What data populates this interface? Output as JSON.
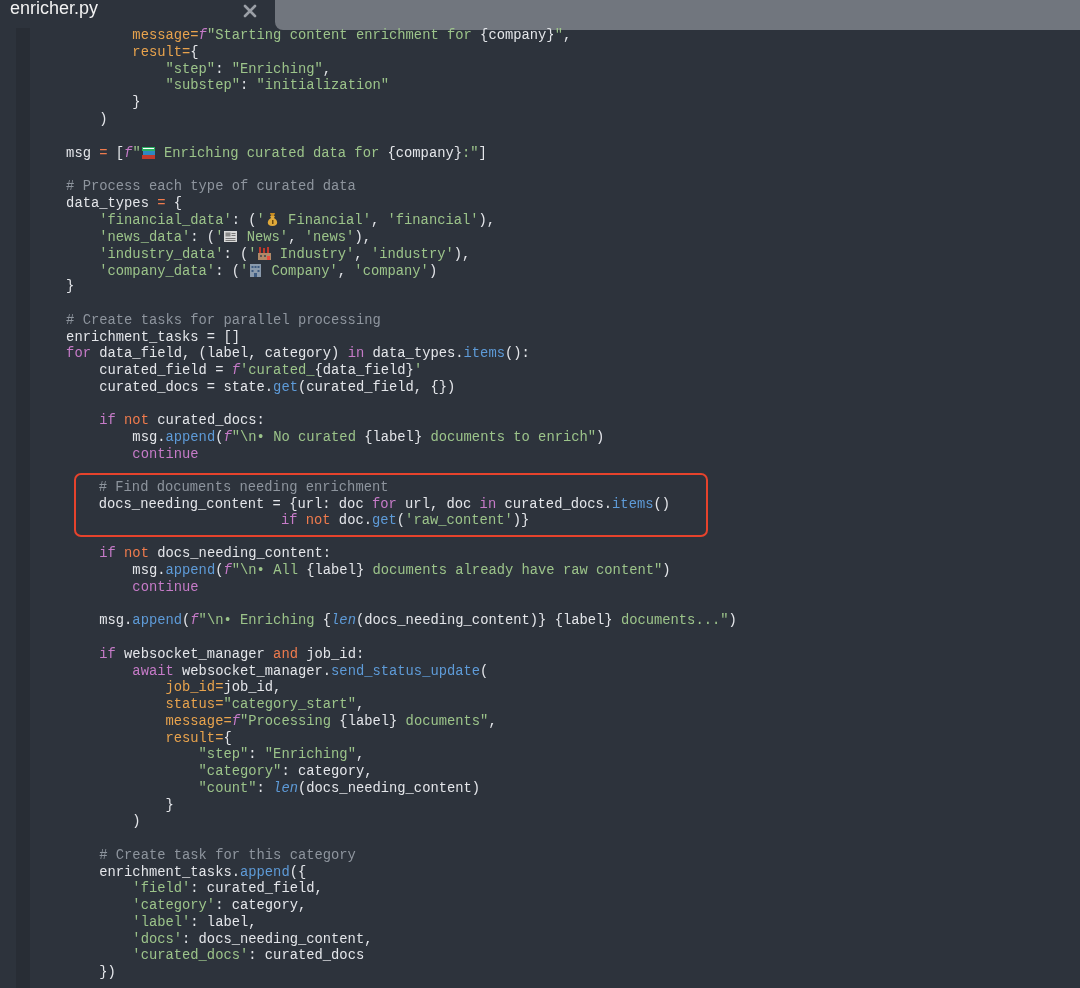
{
  "tab": {
    "title": "enricher.py"
  },
  "blocks": [
    {
      "highlighted": false,
      "lines": [
        {
          "kind": "code",
          "tokens": [
            {
              "kind": "param",
              "text": "            message="
            },
            {
              "kind": "fpre",
              "text": "f"
            },
            {
              "kind": "str",
              "text": "\"Starting content enrichment for "
            },
            {
              "kind": "plain",
              "text": "{company}"
            },
            {
              "kind": "str",
              "text": "\""
            },
            {
              "kind": "plain",
              "text": ","
            }
          ]
        },
        {
          "kind": "code",
          "tokens": [
            {
              "kind": "param",
              "text": "            result="
            },
            {
              "kind": "plain",
              "text": "{"
            }
          ]
        },
        {
          "kind": "code",
          "tokens": [
            {
              "kind": "str",
              "text": "                \"step\""
            },
            {
              "kind": "plain",
              "text": ": "
            },
            {
              "kind": "str",
              "text": "\"Enriching\""
            },
            {
              "kind": "plain",
              "text": ","
            }
          ]
        },
        {
          "kind": "code",
          "tokens": [
            {
              "kind": "str",
              "text": "                \"substep\""
            },
            {
              "kind": "plain",
              "text": ": "
            },
            {
              "kind": "str",
              "text": "\"initialization\""
            }
          ]
        },
        {
          "kind": "code",
          "tokens": [
            {
              "kind": "plain",
              "text": "            }"
            }
          ]
        },
        {
          "kind": "code",
          "tokens": [
            {
              "kind": "plain",
              "text": "        )"
            }
          ]
        },
        {
          "kind": "blank"
        },
        {
          "kind": "code",
          "tokens": [
            {
              "kind": "plain",
              "text": "    msg "
            },
            {
              "kind": "op",
              "text": "="
            },
            {
              "kind": "plain",
              "text": " ["
            },
            {
              "kind": "fpre",
              "text": "f"
            },
            {
              "kind": "str",
              "text": "\""
            },
            {
              "kind": "icon"
            },
            {
              "kind": "str",
              "text": " Enriching curated data for "
            },
            {
              "kind": "plain",
              "text": "{company}"
            },
            {
              "kind": "str",
              "text": ":\""
            },
            {
              "kind": "plain",
              "text": "]"
            }
          ]
        },
        {
          "kind": "blank"
        },
        {
          "kind": "code",
          "tokens": [
            {
              "kind": "cmt",
              "text": "    # Process each type of curated data"
            }
          ]
        },
        {
          "kind": "code",
          "tokens": [
            {
              "kind": "plain",
              "text": "    data_types "
            },
            {
              "kind": "op",
              "text": "="
            },
            {
              "kind": "plain",
              "text": " {"
            }
          ]
        },
        {
          "kind": "code",
          "tokens": [
            {
              "kind": "str",
              "text": "        'financial_data'"
            },
            {
              "kind": "plain",
              "text": ": ("
            },
            {
              "kind": "str",
              "text": "'"
            },
            {
              "kind": "icon"
            },
            {
              "kind": "str",
              "text": " Financial'"
            },
            {
              "kind": "plain",
              "text": ", "
            },
            {
              "kind": "str",
              "text": "'financial'"
            },
            {
              "kind": "plain",
              "text": "),"
            }
          ]
        },
        {
          "kind": "code",
          "tokens": [
            {
              "kind": "str",
              "text": "        'news_data'"
            },
            {
              "kind": "plain",
              "text": ": ("
            },
            {
              "kind": "str",
              "text": "'"
            },
            {
              "kind": "icon"
            },
            {
              "kind": "str",
              "text": " News'"
            },
            {
              "kind": "plain",
              "text": ", "
            },
            {
              "kind": "str",
              "text": "'news'"
            },
            {
              "kind": "plain",
              "text": "),"
            }
          ]
        },
        {
          "kind": "code",
          "tokens": [
            {
              "kind": "str",
              "text": "        'industry_data'"
            },
            {
              "kind": "plain",
              "text": ": ("
            },
            {
              "kind": "str",
              "text": "'"
            },
            {
              "kind": "icon"
            },
            {
              "kind": "str",
              "text": " Industry'"
            },
            {
              "kind": "plain",
              "text": ", "
            },
            {
              "kind": "str",
              "text": "'industry'"
            },
            {
              "kind": "plain",
              "text": "),"
            }
          ]
        },
        {
          "kind": "code",
          "tokens": [
            {
              "kind": "str",
              "text": "        'company_data'"
            },
            {
              "kind": "plain",
              "text": ": ("
            },
            {
              "kind": "str",
              "text": "'"
            },
            {
              "kind": "icon"
            },
            {
              "kind": "str",
              "text": " Company'"
            },
            {
              "kind": "plain",
              "text": ", "
            },
            {
              "kind": "str",
              "text": "'company'"
            },
            {
              "kind": "plain",
              "text": ")"
            }
          ]
        },
        {
          "kind": "code",
          "tokens": [
            {
              "kind": "plain",
              "text": "    }"
            }
          ]
        },
        {
          "kind": "blank"
        },
        {
          "kind": "code",
          "tokens": [
            {
              "kind": "cmt",
              "text": "    # Create tasks for parallel processing"
            }
          ]
        },
        {
          "kind": "code",
          "tokens": [
            {
              "kind": "plain",
              "text": "    enrichment_tasks = []"
            }
          ]
        },
        {
          "kind": "code",
          "tokens": [
            {
              "kind": "kw",
              "text": "    for"
            },
            {
              "kind": "plain",
              "text": " data_field, (label, category) "
            },
            {
              "kind": "kw",
              "text": "in"
            },
            {
              "kind": "plain",
              "text": " data_types."
            },
            {
              "kind": "fn",
              "text": "items"
            },
            {
              "kind": "plain",
              "text": "():"
            }
          ]
        },
        {
          "kind": "code",
          "tokens": [
            {
              "kind": "plain",
              "text": "        curated_field = "
            },
            {
              "kind": "fpre",
              "text": "f"
            },
            {
              "kind": "str",
              "text": "'curated_"
            },
            {
              "kind": "plain",
              "text": "{data_field}"
            },
            {
              "kind": "str",
              "text": "'"
            }
          ]
        },
        {
          "kind": "code",
          "tokens": [
            {
              "kind": "plain",
              "text": "        curated_docs = state."
            },
            {
              "kind": "fn",
              "text": "get"
            },
            {
              "kind": "plain",
              "text": "(curated_field, {})"
            }
          ]
        },
        {
          "kind": "blank"
        },
        {
          "kind": "code",
          "tokens": [
            {
              "kind": "kw",
              "text": "        if"
            },
            {
              "kind": "op",
              "text": " not"
            },
            {
              "kind": "plain",
              "text": " curated_docs:"
            }
          ]
        },
        {
          "kind": "code",
          "tokens": [
            {
              "kind": "plain",
              "text": "            msg."
            },
            {
              "kind": "fn",
              "text": "append"
            },
            {
              "kind": "plain",
              "text": "("
            },
            {
              "kind": "fpre",
              "text": "f"
            },
            {
              "kind": "str",
              "text": "\"\\n• No curated "
            },
            {
              "kind": "plain",
              "text": "{label}"
            },
            {
              "kind": "str",
              "text": " documents to enrich\""
            },
            {
              "kind": "plain",
              "text": ")"
            }
          ]
        },
        {
          "kind": "code",
          "tokens": [
            {
              "kind": "kw",
              "text": "            continue"
            }
          ]
        },
        {
          "kind": "blank"
        }
      ]
    },
    {
      "highlighted": true,
      "lines": [
        {
          "kind": "code",
          "tokens": [
            {
              "kind": "cmt",
              "text": "        # Find documents needing enrichment"
            }
          ]
        },
        {
          "kind": "code",
          "tokens": [
            {
              "kind": "plain",
              "text": "        docs_needing_content = {url: doc "
            },
            {
              "kind": "kw",
              "text": "for"
            },
            {
              "kind": "plain",
              "text": " url, doc "
            },
            {
              "kind": "kw",
              "text": "in"
            },
            {
              "kind": "plain",
              "text": " curated_docs."
            },
            {
              "kind": "fn",
              "text": "items"
            },
            {
              "kind": "plain",
              "text": "()"
            }
          ]
        },
        {
          "kind": "code",
          "tokens": [
            {
              "kind": "kw",
              "text": "                              if"
            },
            {
              "kind": "op",
              "text": " not"
            },
            {
              "kind": "plain",
              "text": " doc."
            },
            {
              "kind": "fn",
              "text": "get"
            },
            {
              "kind": "plain",
              "text": "("
            },
            {
              "kind": "str",
              "text": "'raw_content'"
            },
            {
              "kind": "plain",
              "text": ")}"
            }
          ]
        }
      ]
    },
    {
      "highlighted": false,
      "lines": [
        {
          "kind": "blank"
        },
        {
          "kind": "code",
          "tokens": [
            {
              "kind": "kw",
              "text": "        if"
            },
            {
              "kind": "op",
              "text": " not"
            },
            {
              "kind": "plain",
              "text": " docs_needing_content:"
            }
          ]
        },
        {
          "kind": "code",
          "tokens": [
            {
              "kind": "plain",
              "text": "            msg."
            },
            {
              "kind": "fn",
              "text": "append"
            },
            {
              "kind": "plain",
              "text": "("
            },
            {
              "kind": "fpre",
              "text": "f"
            },
            {
              "kind": "str",
              "text": "\"\\n• All "
            },
            {
              "kind": "plain",
              "text": "{label}"
            },
            {
              "kind": "str",
              "text": " documents already have raw content\""
            },
            {
              "kind": "plain",
              "text": ")"
            }
          ]
        },
        {
          "kind": "code",
          "tokens": [
            {
              "kind": "kw",
              "text": "            continue"
            }
          ]
        },
        {
          "kind": "blank"
        },
        {
          "kind": "code",
          "tokens": [
            {
              "kind": "plain",
              "text": "        msg."
            },
            {
              "kind": "fn",
              "text": "append"
            },
            {
              "kind": "plain",
              "text": "("
            },
            {
              "kind": "fpre",
              "text": "f"
            },
            {
              "kind": "str",
              "text": "\"\\n• Enriching "
            },
            {
              "kind": "plain",
              "text": "{"
            },
            {
              "kind": "builtin",
              "text": "len"
            },
            {
              "kind": "plain",
              "text": "(docs_needing_content)} {label}"
            },
            {
              "kind": "str",
              "text": " documents...\""
            },
            {
              "kind": "plain",
              "text": ")"
            }
          ]
        },
        {
          "kind": "blank"
        },
        {
          "kind": "code",
          "tokens": [
            {
              "kind": "kw",
              "text": "        if"
            },
            {
              "kind": "plain",
              "text": " websocket_manager "
            },
            {
              "kind": "op",
              "text": "and"
            },
            {
              "kind": "plain",
              "text": " job_id:"
            }
          ]
        },
        {
          "kind": "code",
          "tokens": [
            {
              "kind": "kw",
              "text": "            await"
            },
            {
              "kind": "plain",
              "text": " websocket_manager."
            },
            {
              "kind": "fn",
              "text": "send_status_update"
            },
            {
              "kind": "plain",
              "text": "("
            }
          ]
        },
        {
          "kind": "code",
          "tokens": [
            {
              "kind": "param",
              "text": "                job_id="
            },
            {
              "kind": "plain",
              "text": "job_id,"
            }
          ]
        },
        {
          "kind": "code",
          "tokens": [
            {
              "kind": "param",
              "text": "                status="
            },
            {
              "kind": "str",
              "text": "\"category_start\""
            },
            {
              "kind": "plain",
              "text": ","
            }
          ]
        },
        {
          "kind": "code",
          "tokens": [
            {
              "kind": "param",
              "text": "                message="
            },
            {
              "kind": "fpre",
              "text": "f"
            },
            {
              "kind": "str",
              "text": "\"Processing "
            },
            {
              "kind": "plain",
              "text": "{label}"
            },
            {
              "kind": "str",
              "text": " documents\""
            },
            {
              "kind": "plain",
              "text": ","
            }
          ]
        },
        {
          "kind": "code",
          "tokens": [
            {
              "kind": "param",
              "text": "                result="
            },
            {
              "kind": "plain",
              "text": "{"
            }
          ]
        },
        {
          "kind": "code",
          "tokens": [
            {
              "kind": "str",
              "text": "                    \"step\""
            },
            {
              "kind": "plain",
              "text": ": "
            },
            {
              "kind": "str",
              "text": "\"Enriching\""
            },
            {
              "kind": "plain",
              "text": ","
            }
          ]
        },
        {
          "kind": "code",
          "tokens": [
            {
              "kind": "str",
              "text": "                    \"category\""
            },
            {
              "kind": "plain",
              "text": ": category,"
            }
          ]
        },
        {
          "kind": "code",
          "tokens": [
            {
              "kind": "str",
              "text": "                    \"count\""
            },
            {
              "kind": "plain",
              "text": ": "
            },
            {
              "kind": "builtin",
              "text": "len"
            },
            {
              "kind": "plain",
              "text": "(docs_needing_content)"
            }
          ]
        },
        {
          "kind": "code",
          "tokens": [
            {
              "kind": "plain",
              "text": "                }"
            }
          ]
        },
        {
          "kind": "code",
          "tokens": [
            {
              "kind": "plain",
              "text": "            )"
            }
          ]
        },
        {
          "kind": "blank"
        },
        {
          "kind": "code",
          "tokens": [
            {
              "kind": "cmt",
              "text": "        # Create task for this category"
            }
          ]
        },
        {
          "kind": "code",
          "tokens": [
            {
              "kind": "plain",
              "text": "        enrichment_tasks."
            },
            {
              "kind": "fn",
              "text": "append"
            },
            {
              "kind": "plain",
              "text": "({"
            }
          ]
        },
        {
          "kind": "code",
          "tokens": [
            {
              "kind": "str",
              "text": "            'field'"
            },
            {
              "kind": "plain",
              "text": ": curated_field,"
            }
          ]
        },
        {
          "kind": "code",
          "tokens": [
            {
              "kind": "str",
              "text": "            'category'"
            },
            {
              "kind": "plain",
              "text": ": category,"
            }
          ]
        },
        {
          "kind": "code",
          "tokens": [
            {
              "kind": "str",
              "text": "            'label'"
            },
            {
              "kind": "plain",
              "text": ": label,"
            }
          ]
        },
        {
          "kind": "code",
          "tokens": [
            {
              "kind": "str",
              "text": "            'docs'"
            },
            {
              "kind": "plain",
              "text": ": docs_needing_content,"
            }
          ]
        },
        {
          "kind": "code",
          "tokens": [
            {
              "kind": "str",
              "text": "            'curated_docs'"
            },
            {
              "kind": "plain",
              "text": ": curated_docs"
            }
          ]
        },
        {
          "kind": "code",
          "tokens": [
            {
              "kind": "plain",
              "text": "        })"
            }
          ]
        }
      ]
    }
  ]
}
